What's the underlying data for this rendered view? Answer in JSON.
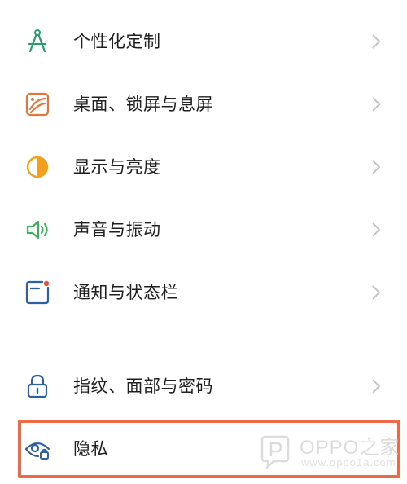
{
  "settings": {
    "items": [
      {
        "label": "个性化定制",
        "icon": "compass-icon",
        "color": "#2a9d6e"
      },
      {
        "label": "桌面、锁屏与息屏",
        "icon": "wallpaper-icon",
        "color": "#e0763a"
      },
      {
        "label": "显示与亮度",
        "icon": "brightness-icon",
        "color": "#f0a020"
      },
      {
        "label": "声音与振动",
        "icon": "speaker-icon",
        "color": "#3fae5c"
      },
      {
        "label": "通知与状态栏",
        "icon": "notification-icon",
        "color": "#2e5fa3"
      },
      {
        "label": "指纹、面部与密码",
        "icon": "lock-icon",
        "color": "#2e5fa3"
      },
      {
        "label": "隐私",
        "icon": "privacy-eye-icon",
        "color": "#2e5fa3"
      }
    ]
  },
  "highlight_color": "#ec6a46",
  "watermark": {
    "text": "OPPO之家",
    "url": "www.oppo1a.com"
  }
}
